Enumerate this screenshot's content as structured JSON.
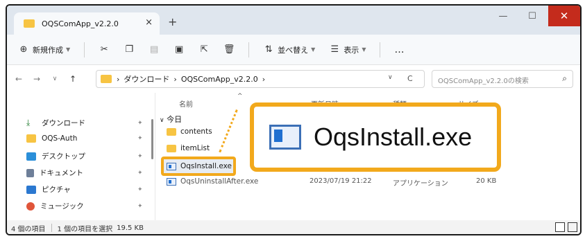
{
  "window": {
    "tab_title": "OQSComApp_v2.2.0",
    "tab_close": "×",
    "new_tab": "+",
    "minimize": "—",
    "maximize": "☐",
    "close": "✕"
  },
  "toolbar": {
    "new_label": "新規作成",
    "sort_label": "並べ替え",
    "view_label": "表示",
    "more": "…"
  },
  "address": {
    "back": "←",
    "forward": "→",
    "recent": "∨",
    "up": "↑",
    "crumbs": [
      "›",
      "ダウンロード",
      "›",
      "OQSComApp_v2.2.0",
      "›"
    ],
    "dropdown": "∨",
    "refresh": "C"
  },
  "search": {
    "placeholder": "OQSComApp_v2.2.0の検索",
    "icon": "⌕"
  },
  "sidebar": {
    "items": [
      {
        "label": "ダウンロード",
        "icon": "download-icon",
        "color": "#1f7a2e"
      },
      {
        "label": "OQS-Auth",
        "icon": "folder-icon",
        "color": "#f7c443"
      },
      {
        "label": "デスクトップ",
        "icon": "desktop-icon",
        "color": "#2b8fd9"
      },
      {
        "label": "ドキュメント",
        "icon": "document-icon",
        "color": "#6e7f99"
      },
      {
        "label": "ピクチャ",
        "icon": "pictures-icon",
        "color": "#2b78d0"
      },
      {
        "label": "ミュージック",
        "icon": "music-icon",
        "color": "#e0553a"
      }
    ],
    "pin": "📌"
  },
  "list": {
    "headers": {
      "name": "名前",
      "date": "更新日時",
      "type": "種類",
      "size": "サイズ"
    },
    "group": "今日",
    "rows": [
      {
        "name": "contents",
        "kind": "folder"
      },
      {
        "name": "itemList",
        "kind": "folder"
      },
      {
        "name": "OqsInstall.exe",
        "kind": "exe"
      },
      {
        "name": "OqsUninstallAfter.exe",
        "kind": "exe",
        "date": "2023/07/19 21:22",
        "type": "アプリケーション",
        "size": "20 KB"
      }
    ]
  },
  "callout": {
    "label": "OqsInstall.exe"
  },
  "status": {
    "count": "4 個の項目",
    "selected": "1 個の項目を選択",
    "size": "19.5 KB"
  },
  "colors": {
    "highlight": "#f2a91c",
    "close": "#c42b1c",
    "folder": "#f7c443"
  }
}
